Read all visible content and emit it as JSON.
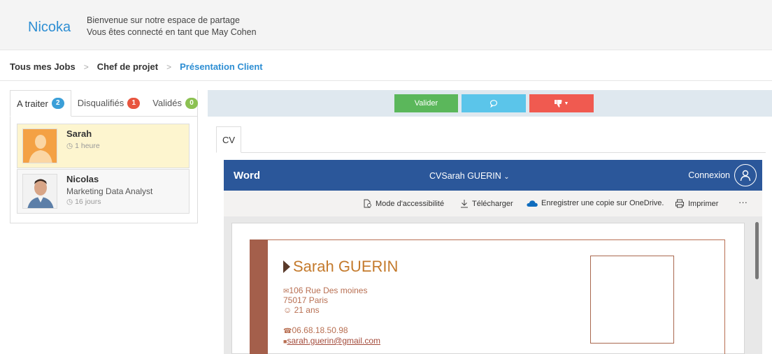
{
  "header": {
    "brand": "Nicoka",
    "welcome_line1": "Bienvenue sur notre espace de partage",
    "welcome_line2": "Vous êtes connecté en tant que May Cohen"
  },
  "breadcrumb": {
    "items": [
      "Tous mes Jobs",
      "Chef de projet",
      "Présentation Client"
    ],
    "separator": ">"
  },
  "tabs": [
    {
      "label": "A traiter",
      "count": "2",
      "color": "#3b9fd8"
    },
    {
      "label": "Disqualifiés",
      "count": "1",
      "color": "#e8553f"
    },
    {
      "label": "Validés",
      "count": "0",
      "color": "#8cc152"
    }
  ],
  "candidates": [
    {
      "name": "Sarah",
      "subtitle": "",
      "time": "1 heure",
      "time_icon": "clock-icon"
    },
    {
      "name": "Nicolas",
      "subtitle": "Marketing Data Analyst",
      "time": "16 jours",
      "time_icon": "clock-icon"
    }
  ],
  "actions": {
    "validate_label": "Valider",
    "comment_icon": "comment-icon",
    "reject_icon": "thumbs-down-icon",
    "colors": {
      "validate": "#5bb75b",
      "comment": "#5bc5ea",
      "reject": "#f05a50"
    }
  },
  "doc_tab": {
    "label": "CV"
  },
  "word": {
    "app_name": "Word",
    "document": "CVSarah GUERIN",
    "login": "Connexion",
    "brand_color": "#2b579a",
    "tools": [
      "Mode d'accessibilité",
      "Télécharger",
      "Enregistrer une copie sur OneDrive.",
      "Imprimer",
      "···"
    ]
  },
  "cv": {
    "name": "Sarah GUERIN",
    "address_line1": "106 Rue Des moines",
    "address_line2": "75017 Paris",
    "age": "21 ans",
    "phone": "06.68.18.50.98",
    "email": "sarah.guerin@gmail.com",
    "accent_color": "#a45f4b"
  }
}
